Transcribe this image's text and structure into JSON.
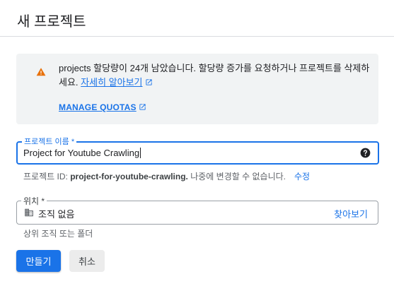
{
  "dialog": {
    "title": "새 프로젝트"
  },
  "alert": {
    "icon": "warning-icon",
    "color": "#e8710a",
    "message": "projects 할당량이 24개 남았습니다. 할당량 증가를 요청하거나 프로젝트를 삭제하세요.",
    "learn_more": "자세히 알아보기",
    "manage_quotas": "MANAGE QUOTAS"
  },
  "project_name": {
    "label": "프로젝트 이름 *",
    "value": "Project for Youtube Crawling",
    "help_icon": "help-icon"
  },
  "project_id": {
    "prefix": "프로젝트 ID:",
    "value": "project-for-youtube-crawling.",
    "suffix": "나중에 변경할 수 없습니다.",
    "edit": "수정"
  },
  "location": {
    "label": "위치 *",
    "icon": "organization-icon",
    "value": "조직 없음",
    "browse": "찾아보기",
    "helper": "상위 조직 또는 폴더"
  },
  "buttons": {
    "create": "만들기",
    "cancel": "취소"
  },
  "colors": {
    "primary": "#1a73e8",
    "warning": "#e8710a"
  }
}
